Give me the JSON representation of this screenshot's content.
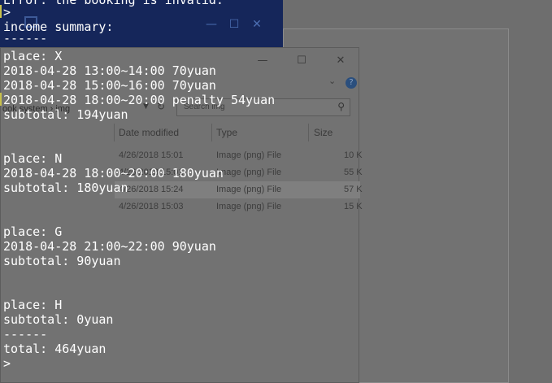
{
  "background": {
    "blue_window": {
      "controls": [
        "—",
        "☐",
        "✕"
      ]
    },
    "explorer": {
      "controls": [
        "—",
        "☐",
        "✕"
      ],
      "address_tail": "ook system  ›  img",
      "search_placeholder": "Search img",
      "columns": [
        "Date modified",
        "Type",
        "Size"
      ],
      "rows": [
        {
          "date": "4/26/2018 15:01",
          "type": "Image (png) File",
          "size": "10 K"
        },
        {
          "date": "4/26/2018 15:01",
          "type": "Image (png) File",
          "size": "55 K"
        },
        {
          "date": "4/26/2018 15:24",
          "type": "Image (png) File",
          "size": "57 K",
          "selected": true
        },
        {
          "date": "4/26/2018 15:03",
          "type": "Image (png) File",
          "size": "15 K"
        }
      ]
    }
  },
  "console": {
    "lines": [
      "Error: the booking is invalid.",
      ">",
      "income summary:",
      "------",
      "place: X",
      "2018-04-28 13:00~14:00 70yuan",
      "2018-04-28 15:00~16:00 70yuan",
      "2018-04-28 18:00~20:00 penalty 54yuan",
      "subtotal: 194yuan",
      "",
      "place: N",
      "2018-04-28 18:00~20:00 180yuan",
      "subtotal: 180yuan",
      "",
      "",
      "place: G",
      "2018-04-28 21:00~22:00 90yuan",
      "subtotal: 90yuan",
      "",
      "",
      "place: H",
      "subtotal: 0yuan",
      "------",
      "total: 464yuan",
      ">"
    ]
  }
}
